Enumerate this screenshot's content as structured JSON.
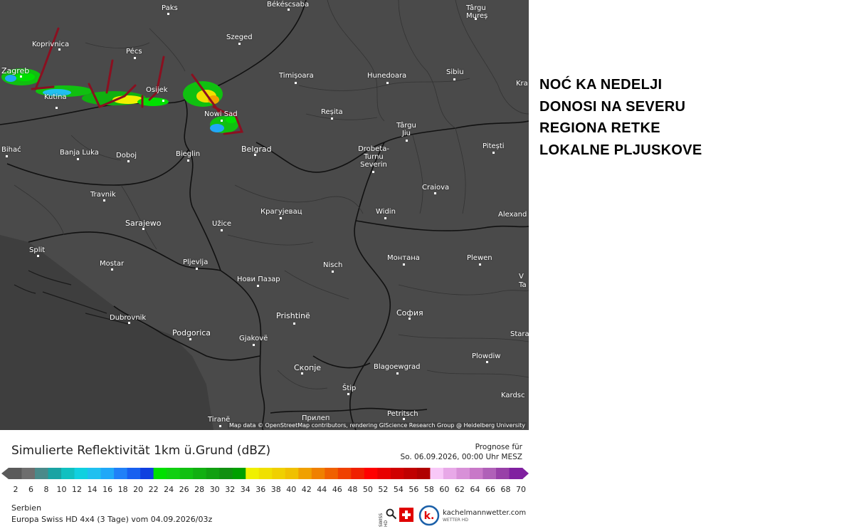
{
  "caption": {
    "lines": [
      "NOĆ KA NEDELJI",
      "DONOSI NA SEVERU",
      "REGIONA RETKE",
      "LOKALNE PLJUSKOVE"
    ]
  },
  "map": {
    "attribution": "Map data © OpenStreetMap contributors, rendering GIScience Research Group @ Heidelberg University",
    "cities": [
      {
        "name": "Paks"
      },
      {
        "name": "Békéscsaba"
      },
      {
        "name": "Târgu Mureș"
      },
      {
        "name": "Koprivnica"
      },
      {
        "name": "Szeged"
      },
      {
        "name": "Pécs"
      },
      {
        "name": "Zagreb"
      },
      {
        "name": "Timișoara"
      },
      {
        "name": "Hunedoara"
      },
      {
        "name": "Sibiu"
      },
      {
        "name": "Kra"
      },
      {
        "name": "Osijek"
      },
      {
        "name": "Kutina"
      },
      {
        "name": "Nowi Sad"
      },
      {
        "name": "Reșita"
      },
      {
        "name": "Târgu Jiu"
      },
      {
        "name": "Bihać"
      },
      {
        "name": "Banja Luka"
      },
      {
        "name": "Doboj"
      },
      {
        "name": "Bieglin"
      },
      {
        "name": "Belgrad"
      },
      {
        "name": "Drobeta-Turnu Severin"
      },
      {
        "name": "Pitești"
      },
      {
        "name": "Craiova"
      },
      {
        "name": "Travnik"
      },
      {
        "name": "Крагујевац"
      },
      {
        "name": "Widin"
      },
      {
        "name": "Alexand"
      },
      {
        "name": "Sarajewo"
      },
      {
        "name": "Užice"
      },
      {
        "name": "Split"
      },
      {
        "name": "Mostar"
      },
      {
        "name": "Pljevlja"
      },
      {
        "name": "Nisch"
      },
      {
        "name": "Монтана"
      },
      {
        "name": "Plewen"
      },
      {
        "name": "Нови Пазар"
      },
      {
        "name": "V Ta"
      },
      {
        "name": "Dubrovnik"
      },
      {
        "name": "Prishtinë"
      },
      {
        "name": "София"
      },
      {
        "name": "Podgorica"
      },
      {
        "name": "Gjakovë"
      },
      {
        "name": "Stara"
      },
      {
        "name": "Plowdiw"
      },
      {
        "name": "Скопје"
      },
      {
        "name": "Blagoewgrad"
      },
      {
        "name": "Štip"
      },
      {
        "name": "Kardsc"
      },
      {
        "name": "Tiranë"
      },
      {
        "name": "Прилеп"
      },
      {
        "name": "Petritsch"
      }
    ]
  },
  "legend": {
    "title": "Simulierte Reflektivität 1km ü.Grund (dBZ)",
    "forecast_label": "Prognose für",
    "forecast_time": "So. 06.09.2026, 00:00 Uhr MESZ",
    "ticks": [
      "2",
      "6",
      "8",
      "10",
      "12",
      "14",
      "16",
      "18",
      "20",
      "22",
      "24",
      "26",
      "28",
      "30",
      "32",
      "34",
      "36",
      "38",
      "40",
      "42",
      "44",
      "46",
      "48",
      "50",
      "52",
      "54",
      "56",
      "58",
      "60",
      "62",
      "64",
      "66",
      "68",
      "70"
    ],
    "colors": [
      "#5a5a5a",
      "#6e6e6e",
      "#4a8a8a",
      "#1aa3a3",
      "#10c0c0",
      "#10d0e0",
      "#20c0f0",
      "#20a8f8",
      "#2080f8",
      "#1860f0",
      "#1040e0",
      "#00e000",
      "#10d010",
      "#10c010",
      "#10b010",
      "#10a010",
      "#109010",
      "#00a000",
      "#f0f000",
      "#f0e000",
      "#f0d000",
      "#f0c000",
      "#f0a000",
      "#f08000",
      "#f06000",
      "#f04000",
      "#f02000",
      "#ff0000",
      "#e80000",
      "#d00000",
      "#c00000",
      "#b00000",
      "#f8c8f8",
      "#e8a8e8",
      "#d890d8",
      "#c878c8",
      "#b060b8",
      "#9840a8",
      "#8020a0"
    ],
    "region": "Serbien",
    "model": "Europa Swiss HD 4x4 (3 Tage) vom 04.09.2026/03z"
  },
  "brand": {
    "name": "kachelmannwetter.com",
    "sub": "WETTER HD",
    "swiss_label": "SWISS HD"
  }
}
